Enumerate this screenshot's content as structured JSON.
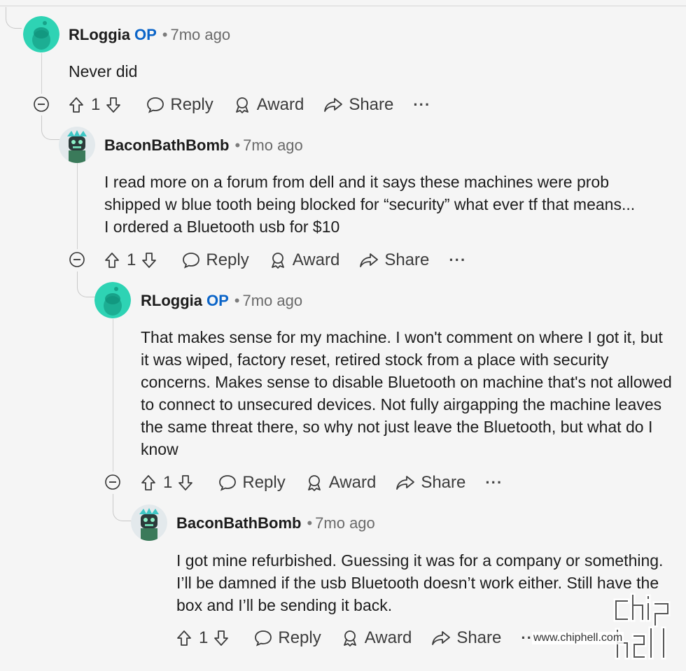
{
  "comments": [
    {
      "author": "RLoggia",
      "op_badge": "OP",
      "separator": "•",
      "time": "7mo ago",
      "body": "Never did",
      "votes": "1",
      "reply_label": "Reply",
      "award_label": "Award",
      "share_label": "Share",
      "more_label": "···",
      "avatar": "snoo-avatar-green"
    },
    {
      "author": "BaconBathBomb",
      "op_badge": "",
      "separator": "•",
      "time": "7mo ago",
      "body": "I read more on a forum from dell and it says these machines were prob shipped w blue tooth being blocked for “security” what ever tf that means... I ordered a Bluetooth usb for $10",
      "votes": "1",
      "reply_label": "Reply",
      "award_label": "Award",
      "share_label": "Share",
      "more_label": "···",
      "avatar": "custom-avatar-teal"
    },
    {
      "author": "RLoggia",
      "op_badge": "OP",
      "separator": "•",
      "time": "7mo ago",
      "body": "That makes sense for my machine. I won't comment on where I got it, but it was wiped, factory reset, retired stock from a place with security concerns. Makes sense to disable Bluetooth on machine that's not allowed to connect to unsecured devices. Not fully airgapping the machine leaves the same threat there, so why not just leave the Bluetooth, but what do I know",
      "votes": "1",
      "reply_label": "Reply",
      "award_label": "Award",
      "share_label": "Share",
      "more_label": "···",
      "avatar": "snoo-avatar-green"
    },
    {
      "author": "BaconBathBomb",
      "op_badge": "",
      "separator": "•",
      "time": "7mo ago",
      "body": "I got mine refurbished. Guessing it was for a company or something. I’ll be damned if the usb Bluetooth doesn’t work either. Still have the box and I’ll be sending it back.",
      "votes": "1",
      "reply_label": "Reply",
      "award_label": "Award",
      "share_label": "Share",
      "more_label": "···",
      "avatar": "custom-avatar-teal"
    }
  ],
  "watermark": {
    "logo_text": "chip hell",
    "url": "www.chiphell.com"
  },
  "colors": {
    "op_blue": "#0a64c8",
    "snoo_green": "#2ed3b4",
    "background": "#f5f5f5"
  }
}
